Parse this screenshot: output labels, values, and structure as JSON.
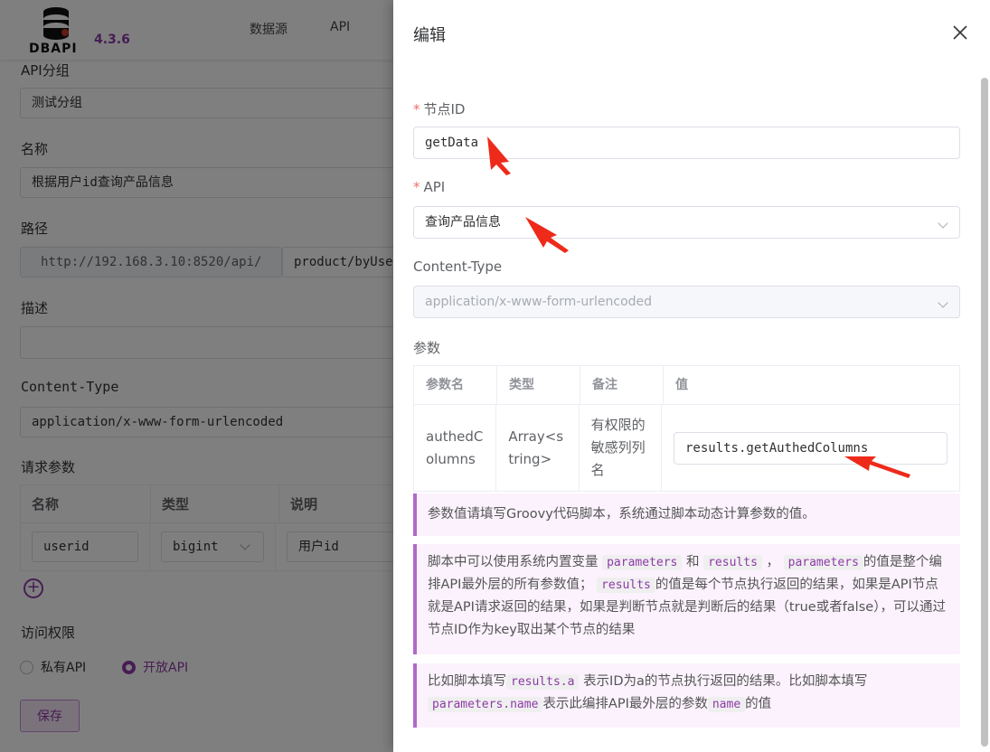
{
  "header": {
    "logo_text": "DBAPI",
    "version": "4.3.6",
    "nav": [
      "数据源",
      "API"
    ]
  },
  "form": {
    "group_label": "API分组",
    "group_value": "测试分组",
    "name_label": "名称",
    "name_value": "根据用户id查询产品信息",
    "path_label": "路径",
    "path_prefix": "http://192.168.3.10:8520/api/",
    "path_value": "product/byUse",
    "desc_label": "描述",
    "content_type_label": "Content-Type",
    "content_type_value": "application/x-www-form-urlencoded",
    "request_params_label": "请求参数",
    "params_headers": [
      "名称",
      "类型",
      "说明"
    ],
    "param_row": {
      "name": "userid",
      "type": "bigint",
      "desc": "用户id"
    },
    "access_label": "访问权限",
    "access_private": "私有API",
    "access_public": "开放API",
    "save_label": "保存"
  },
  "drawer": {
    "title": "编辑",
    "node_id_label": "节点ID",
    "node_id_value": "getData",
    "api_label": "API",
    "api_value": "查询产品信息",
    "content_type_label": "Content-Type",
    "content_type_value": "application/x-www-form-urlencoded",
    "params_label": "参数",
    "table_headers": [
      "参数名",
      "类型",
      "备注",
      "值"
    ],
    "param_name": "authedColumns",
    "param_type": "Array<string>",
    "param_note": "有权限的敏感列列名",
    "param_value": "results.getAuthedColumns",
    "tip1": "参数值请填写Groovy代码脚本，系统通过脚本动态计算参数的值。",
    "tip2_a": "脚本中可以使用系统内置变量",
    "tip2_code1": "parameters",
    "tip2_b": "和",
    "tip2_code2": "results",
    "tip2_c": "，",
    "tip2_code3": "parameters",
    "tip2_d": "的值是整个编排API最外层的所有参数值；",
    "tip2_code4": "results",
    "tip2_e": "的值是每个节点执行返回的结果，如果是API节点就是API请求返回的结果，如果是判断节点就是判断后的结果（true或者false），可以通过节点ID作为key取出某个节点的结果",
    "tip3_a": "比如脚本填写",
    "tip3_code1": "results.a",
    "tip3_b": "表示ID为a的节点执行返回的结果。比如脚本填写",
    "tip3_code2": "parameters.name",
    "tip3_c": "表示此编排API最外层的参数",
    "tip3_code3": "name",
    "tip3_d": "的值"
  },
  "colors": {
    "accent": "#8e3aa8",
    "arrow": "#ee2a1b",
    "required": "#f56c6c"
  }
}
